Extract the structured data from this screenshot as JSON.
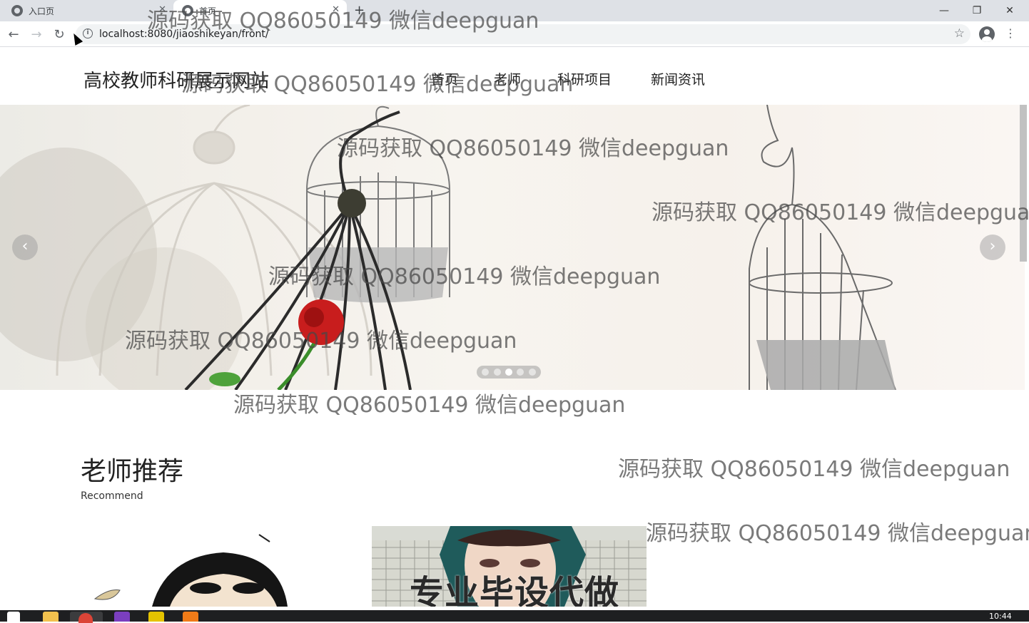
{
  "browser": {
    "tabs": [
      {
        "label": "入口页",
        "active": false
      },
      {
        "label": "首页",
        "active": true
      }
    ],
    "url": "localhost:8080/jiaoshikeyan/front/"
  },
  "site": {
    "title": "高校教师科研展示网站",
    "nav": [
      "首页",
      "老师",
      "科研项目",
      "新闻资讯"
    ]
  },
  "carousel": {
    "slide_count": 5,
    "active_index": 2,
    "prev_glyph": "‹",
    "next_glyph": "›"
  },
  "section": {
    "title": "老师推荐",
    "subtitle": "Recommend"
  },
  "teacher_cards": [
    {
      "image_text": ""
    },
    {
      "image_text": "专业毕设代做"
    }
  ],
  "watermark": "源码获取 QQ86050149 微信deepguan",
  "taskbar": {
    "clock": "10:44"
  },
  "colors": {
    "tabbar_bg": "#dee1e6",
    "taskbar_bg": "#1e1f21",
    "watermark": "#464646"
  }
}
